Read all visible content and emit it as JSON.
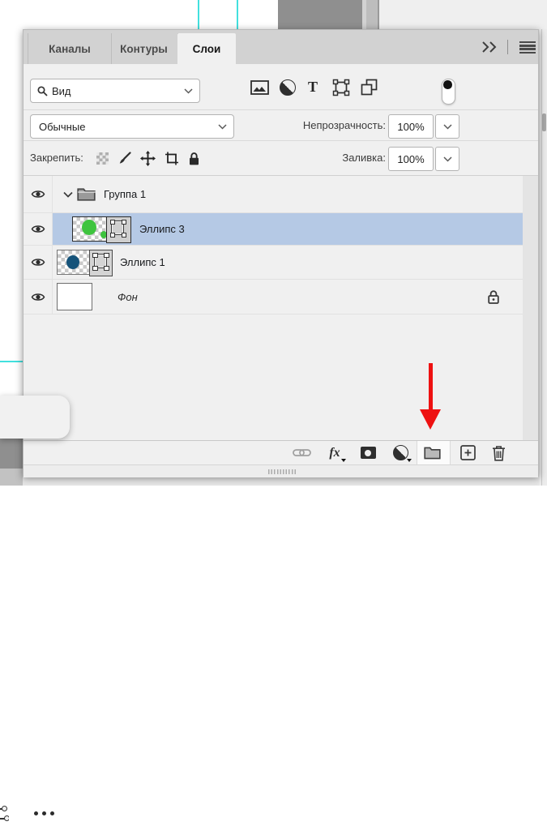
{
  "tabs": [
    {
      "label": "Каналы",
      "active": false
    },
    {
      "label": "Контуры",
      "active": false
    },
    {
      "label": "Слои",
      "active": true
    }
  ],
  "filter_bar": {
    "search_value": "Вид",
    "filter_icons": [
      "pixel-layer-filter",
      "adjustment-layer-filter",
      "type-layer-filter",
      "shape-layer-filter",
      "smart-object-filter"
    ],
    "toggle": "layer-filtering-toggle-on"
  },
  "blend_bar": {
    "blend_mode": "Обычные",
    "opacity_label": "Непрозрачность:",
    "opacity_value": "100%"
  },
  "lock_bar": {
    "label": "Закрепить:",
    "lock_icons": [
      "lock-transparency",
      "lock-image-pixels",
      "lock-position",
      "lock-artboard",
      "lock-all"
    ],
    "fill_label": "Заливка:",
    "fill_value": "100%"
  },
  "layers": [
    {
      "label": "Группа 1",
      "type": "group",
      "visible": true,
      "expanded": true,
      "selected": false
    },
    {
      "label": "Эллипс 3",
      "type": "shape",
      "visible": true,
      "selected": true,
      "shape_color": "#3ec43e"
    },
    {
      "label": "Эллипс 1",
      "type": "shape",
      "visible": true,
      "selected": false,
      "shape_color": "#15537a"
    },
    {
      "label": "Фон",
      "type": "background",
      "visible": true,
      "locked": true,
      "selected": false
    }
  ],
  "footer": {
    "icons": [
      "link-layers",
      "layer-style-fx",
      "add-layer-mask",
      "new-adjustment-layer",
      "new-group",
      "new-layer",
      "delete-layer"
    ],
    "highlighted_icon": "new-group"
  },
  "glyphs": {
    "fx": "fx",
    "type_filter": "T"
  },
  "floating_toolbar": {
    "icon": "more-options-ellipsis"
  },
  "colors": {
    "selection_blue": "#b5c9e5",
    "panel_bg": "#f0f0f0",
    "tab_bar_bg": "#d2d2d2",
    "guide_cyan": "#42e0de",
    "arrow_red": "#ee1111",
    "ellipse3_green": "#3ec43e",
    "ellipse1_blue": "#15537a"
  }
}
